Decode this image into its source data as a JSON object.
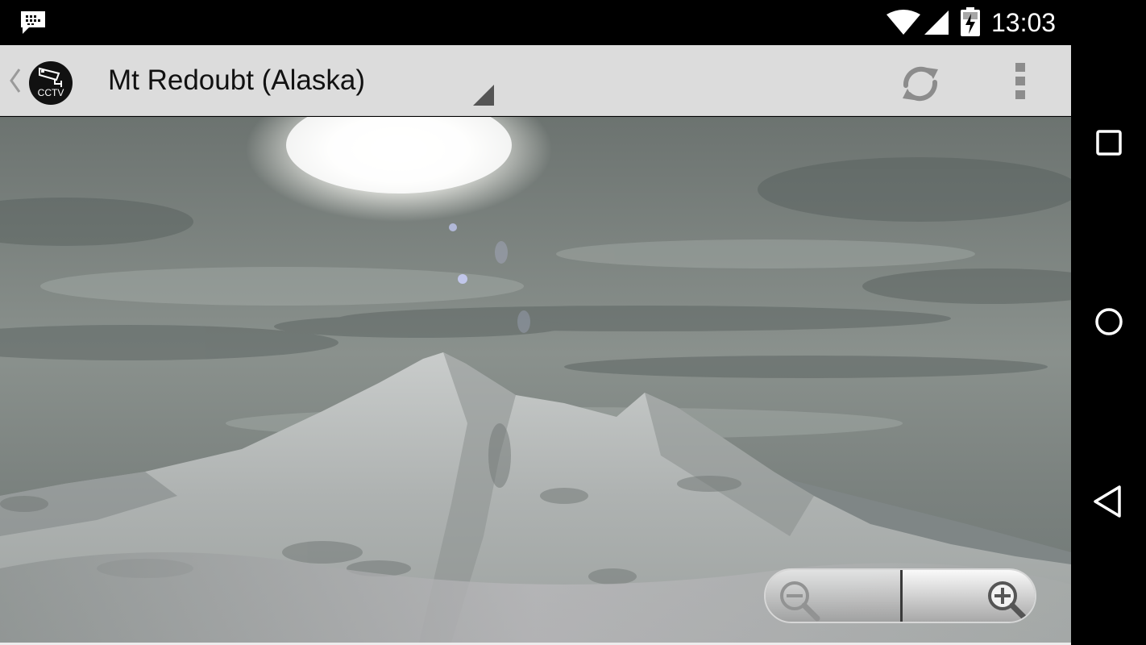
{
  "status_bar": {
    "time": "13:03",
    "icons": [
      "notification-icon",
      "wifi-icon",
      "cell-signal-icon",
      "battery-charging-icon"
    ]
  },
  "action_bar": {
    "app_icon_label": "CCTV",
    "title": "Mt Redoubt (Alaska)",
    "actions": [
      "refresh-icon",
      "overflow-menu-icon"
    ]
  },
  "camera": {
    "subject": "Mt Redoubt (Alaska)"
  },
  "zoom": {
    "out_icon": "zoom-out-icon",
    "in_icon": "zoom-in-icon"
  },
  "nav_bar": {
    "buttons": [
      "recents-icon",
      "home-icon",
      "back-icon"
    ]
  },
  "colors": {
    "action_bar_bg": "#dcdcdc",
    "status_bar_bg": "#000000",
    "title_text": "#111111"
  }
}
